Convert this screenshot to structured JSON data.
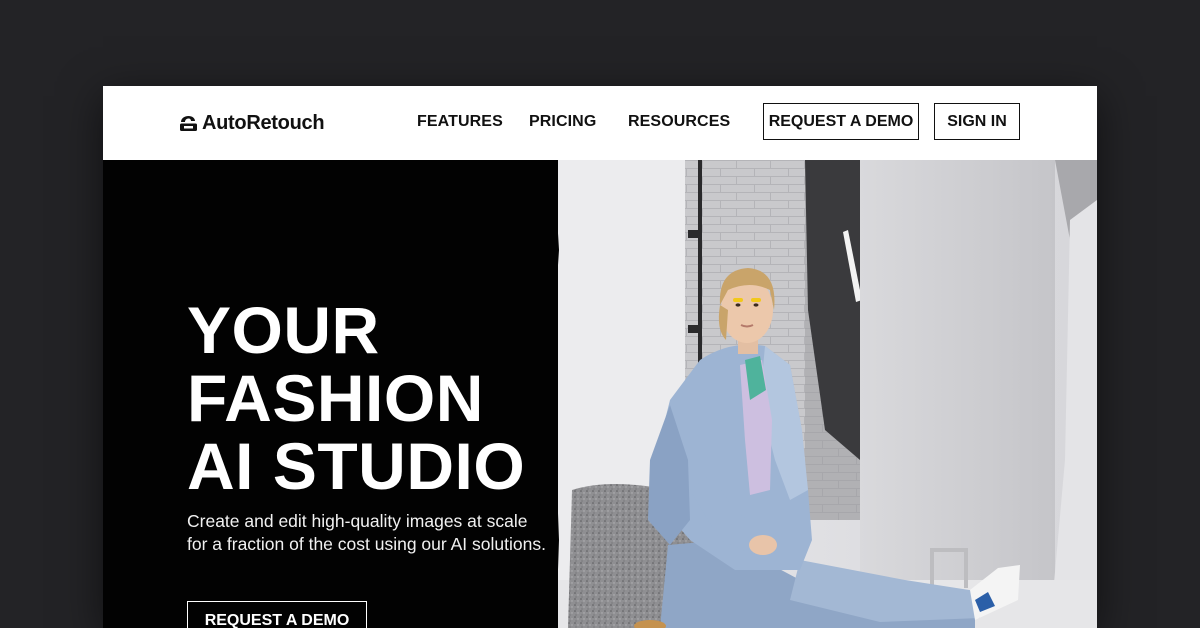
{
  "brand": {
    "name": "AutoRetouch",
    "logo_icon": "autoretouch-logo-icon"
  },
  "nav": {
    "links": [
      "FEATURES",
      "PRICING",
      "RESOURCES"
    ],
    "request_demo_label": "REQUEST A DEMO",
    "sign_in_label": "SIGN IN"
  },
  "hero": {
    "headline": [
      "YOUR",
      "FASHION",
      "AI STUDIO"
    ],
    "subtext": [
      "Create and edit high-quality images at scale",
      "for a fraction of the cost using our AI solutions."
    ],
    "cta_label": "REQUEST A DEMO",
    "image_description": "fashion-model-photo"
  },
  "colors": {
    "page_background": "#232326",
    "nav_background": "#ffffff",
    "hero_background": "#020202",
    "text_dark": "#111111",
    "text_light": "#ffffff"
  }
}
